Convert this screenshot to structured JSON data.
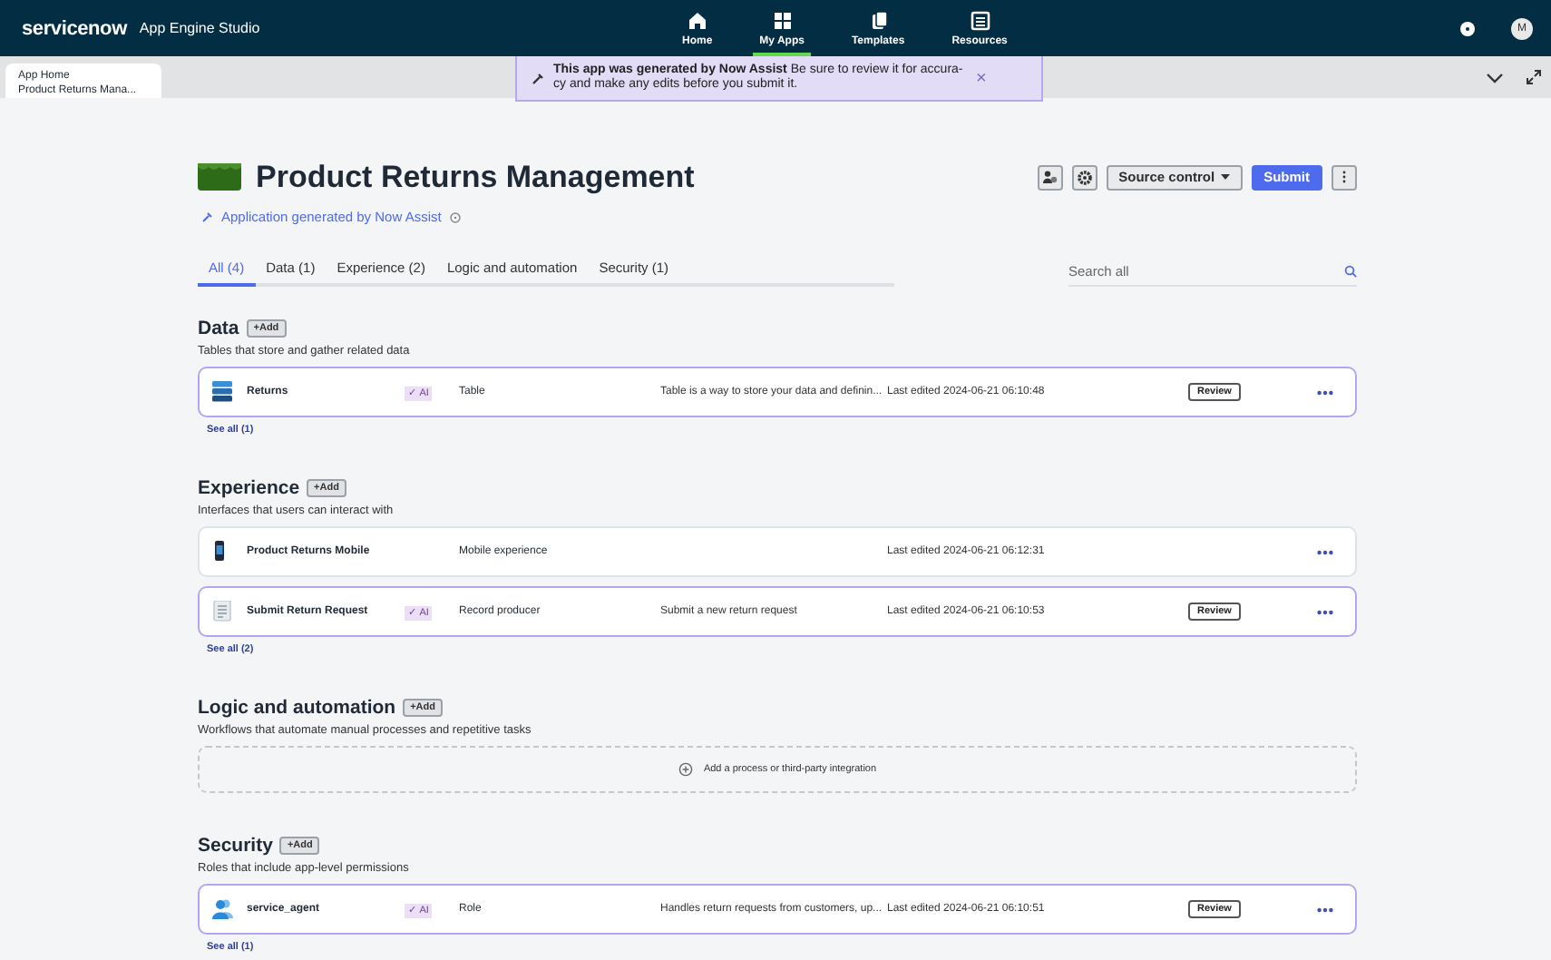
{
  "topbar": {
    "brand": "servicenow",
    "product": "App Engine Studio",
    "nav": [
      {
        "label": "Home",
        "kind": "home",
        "selected": false
      },
      {
        "label": "My Apps",
        "kind": "grid",
        "selected": true
      },
      {
        "label": "Templates",
        "kind": "pages",
        "selected": false
      },
      {
        "label": "Resources",
        "kind": "book",
        "selected": false
      }
    ],
    "avatar": "M"
  },
  "tabstrip": {
    "tabs": [
      {
        "title": "App Home",
        "subtitle": "Product Returns Mana...",
        "selected": true
      }
    ]
  },
  "toast": {
    "message": "**This app was generated by Now Assist** Be sure to review it for accura-cy and make any edits before you submit it.",
    "close": "×"
  },
  "app": {
    "title": "Product Returns Management",
    "generated_note": "Application generated by Now Assist",
    "source_control": "Source control",
    "submit": "Submit"
  },
  "tabs": [
    {
      "label": "All (4)",
      "selected": true
    },
    {
      "label": "Data (1)",
      "selected": false
    },
    {
      "label": "Experience (2)",
      "selected": false
    },
    {
      "label": "Logic and automation",
      "selected": false
    },
    {
      "label": "Security (1)",
      "selected": false
    }
  ],
  "search": {
    "placeholder": "Search all"
  },
  "sections": [
    {
      "title": "Data",
      "add": "+Add",
      "subtitle": "Tables that store and gather related data",
      "see_all": "See all (1)",
      "items": [
        {
          "kind": "table",
          "name": "Returns",
          "ai": "✓ AI",
          "type": "Table",
          "description": "Table is a way to store your data and definin...",
          "edited": "Last edited 2024-06-21 06:10:48",
          "action": "Review"
        }
      ]
    },
    {
      "title": "Experience",
      "add": "+Add",
      "subtitle": "Interfaces that users can interact with",
      "see_all": "See all (2)",
      "items": [
        {
          "kind": "mobile",
          "name": "Product Returns Mobile",
          "type": "Mobile experience",
          "edited": "Last edited 2024-06-21 06:12:31"
        },
        {
          "kind": "form",
          "name": "Submit Return Request",
          "ai": "✓ AI",
          "type": "Record producer",
          "description": "Submit a new return request",
          "edited": "Last edited 2024-06-21 06:10:53",
          "action": "Review"
        }
      ]
    },
    {
      "title": "Logic and automation",
      "add": "+Add",
      "subtitle": "Workflows that automate manual processes and repetitive tasks",
      "empty": "Add a process or third-party integration"
    },
    {
      "title": "Security",
      "add": "+Add",
      "subtitle": "Roles that include app-level permissions",
      "see_all": "See all (1)",
      "items": [
        {
          "kind": "role",
          "name": "service_agent",
          "ai": "✓ AI",
          "type": "Role",
          "description": "Handles return requests from customers, up...",
          "edited": "Last edited 2024-06-21 06:10:51",
          "action": "Review"
        }
      ]
    }
  ]
}
